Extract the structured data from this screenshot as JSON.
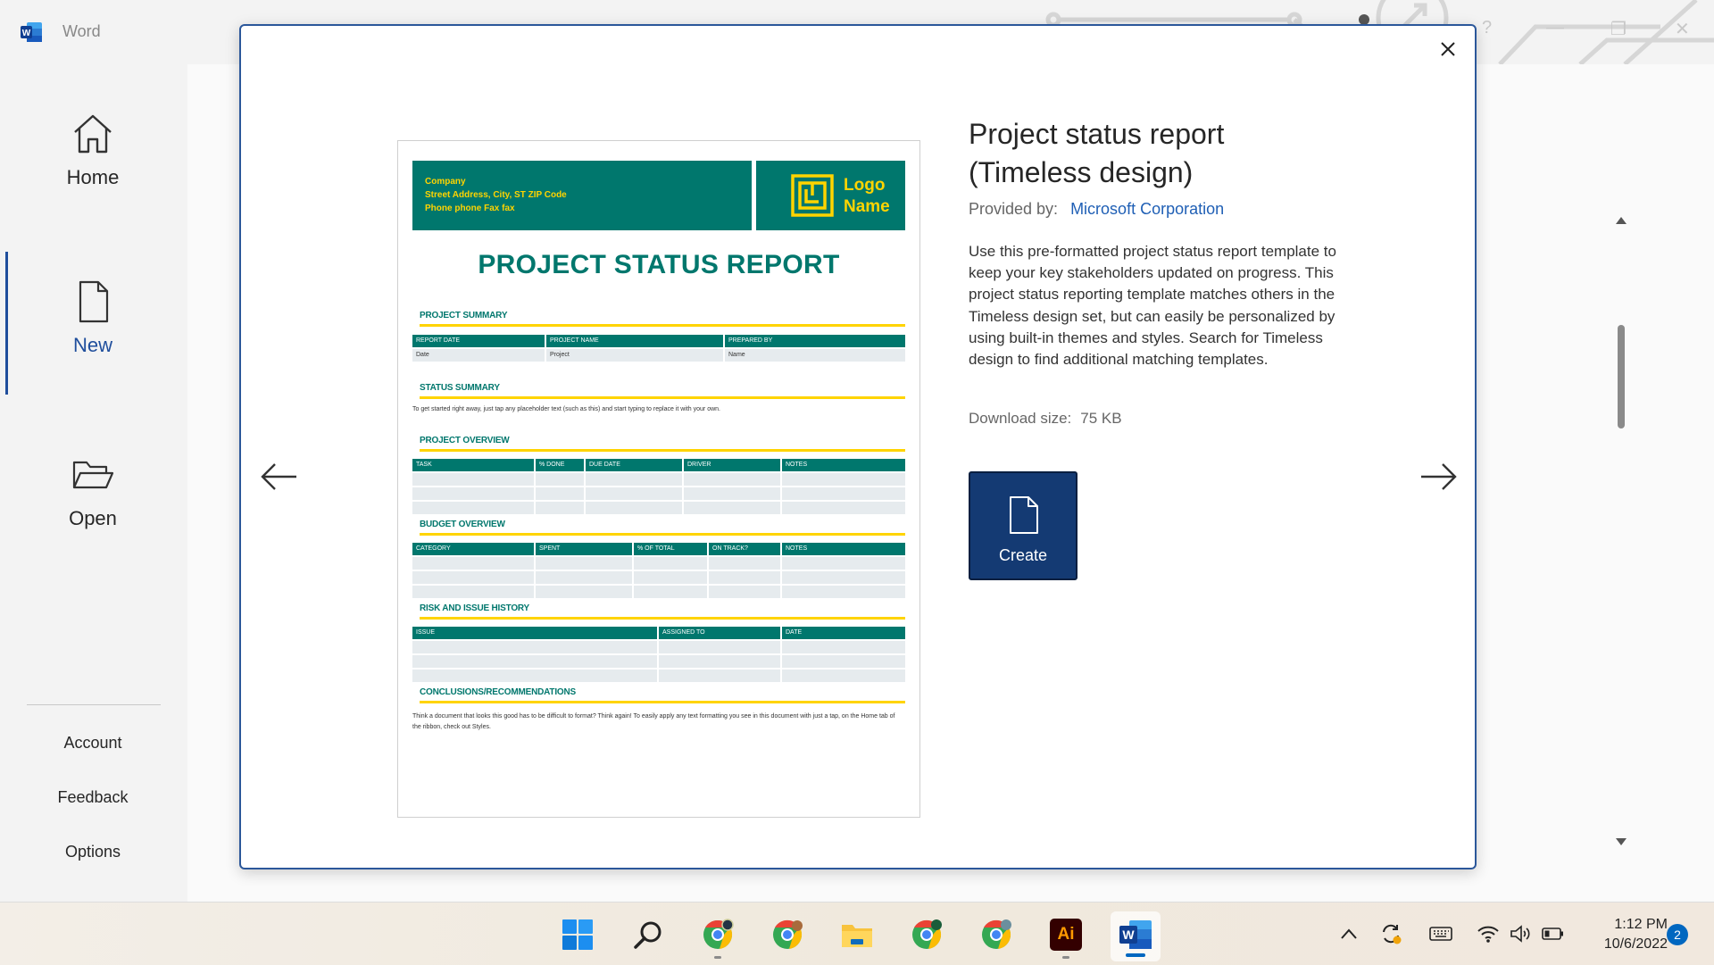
{
  "app": {
    "name": "Word"
  },
  "window_controls": {
    "help": "?",
    "minimize": "—",
    "restore": "❐",
    "close": "✕"
  },
  "nav": {
    "items": [
      {
        "label": "Home",
        "icon": "home-icon"
      },
      {
        "label": "New",
        "icon": "new-document-icon",
        "selected": true
      },
      {
        "label": "Open",
        "icon": "folder-open-icon"
      }
    ],
    "links": [
      "Account",
      "Feedback",
      "Options"
    ]
  },
  "modal": {
    "close_icon": "close-icon",
    "prev_icon": "arrow-left-icon",
    "next_icon": "arrow-right-icon",
    "template_title": "Project status report (Timeless design)",
    "provided_by_label": "Provided by:",
    "provider": "Microsoft Corporation",
    "description": "Use this pre-formatted project status report template to keep your key stakeholders updated on progress. This project status reporting template matches others in the Timeless design set, but can easily be personalized by using built-in themes and styles. Search for Timeless design to find additional matching templates.",
    "download_label": "Download size:",
    "download_size": "75 KB",
    "create_label": "Create"
  },
  "preview": {
    "company_line1": "Company",
    "company_line2": "Street Address, City, ST ZIP Code",
    "company_line3": "Phone phone  Fax fax",
    "logo_line1": "Logo",
    "logo_line2": "Name",
    "title": "PROJECT STATUS REPORT",
    "project_summary": {
      "title": "PROJECT SUMMARY",
      "headers": [
        "REPORT DATE",
        "PROJECT NAME",
        "PREPARED BY"
      ],
      "values": [
        "Date",
        "Project",
        "Name"
      ]
    },
    "status_summary": {
      "title": "STATUS SUMMARY",
      "text": "To get started right away, just tap any placeholder text (such as this) and start typing to replace it with your own."
    },
    "project_overview": {
      "title": "PROJECT OVERVIEW",
      "headers": [
        "TASK",
        "% DONE",
        "DUE DATE",
        "DRIVER",
        "NOTES"
      ]
    },
    "budget_overview": {
      "title": "BUDGET OVERVIEW",
      "headers": [
        "CATEGORY",
        "SPENT",
        "% OF TOTAL",
        "ON TRACK?",
        "NOTES"
      ]
    },
    "risk_history": {
      "title": "RISK AND ISSUE HISTORY",
      "headers": [
        "ISSUE",
        "ASSIGNED TO",
        "DATE"
      ]
    },
    "conclusions": {
      "title": "CONCLUSIONS/RECOMMENDATIONS",
      "text": "Think a document that looks this good has to be difficult to format? Think again! To easily apply any text formatting you see in this document with just a tap, on the Home tab of the ribbon, check out Styles."
    }
  },
  "taskbar": {
    "apps": [
      "start-icon",
      "search-icon",
      "chrome-icon",
      "chrome-icon",
      "file-explorer-icon",
      "chrome-icon",
      "chrome-icon",
      "illustrator-icon",
      "word-icon"
    ],
    "illustrator_label": "Ai",
    "time": "1:12 PM",
    "date": "10/6/2022",
    "notifications": "2"
  },
  "colors": {
    "accent": "#1f4e9c",
    "create_button": "#143a73",
    "template_green": "#00776d",
    "template_yellow": "#ffd400"
  }
}
